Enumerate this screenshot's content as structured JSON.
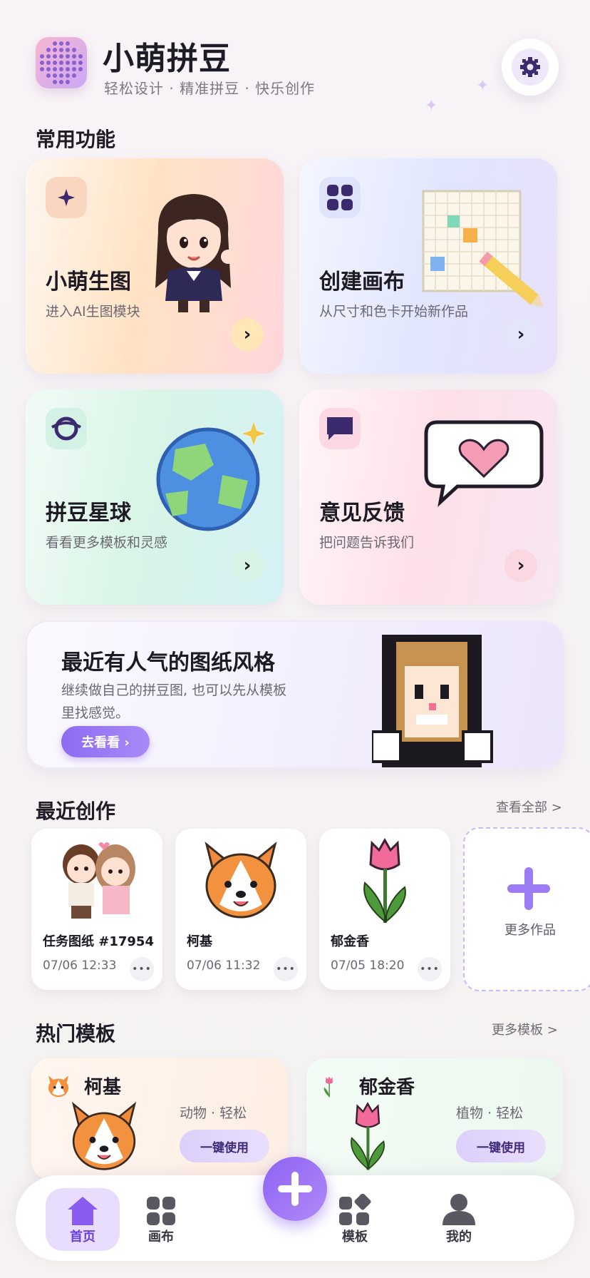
{
  "header": {
    "title": "小萌拼豆",
    "subtitle": "轻松设计 · 精准拼豆 · 快乐创作",
    "settings_icon": "gear-icon",
    "logo_icon": "bead-grid-icon"
  },
  "sections": {
    "common": "常用功能",
    "recent": "最近创作",
    "recent_link": "查看全部 >",
    "hot": "热门模板",
    "hot_link": "更多模板 >"
  },
  "features": [
    {
      "title": "小萌生图",
      "desc": "进入AI生图模块",
      "icon": "sparkle-icon",
      "color": "#f9c2b0"
    },
    {
      "title": "创建画布",
      "desc": "从尺寸和色卡开始新作品",
      "icon": "grid-icon",
      "color": "#c9d1fb"
    },
    {
      "title": "拼豆星球",
      "desc": "看看更多模板和灵感",
      "icon": "planet-icon",
      "color": "#c8f0df"
    },
    {
      "title": "意见反馈",
      "desc": "把问题告诉我们",
      "icon": "chat-icon",
      "color": "#fbc9dc"
    }
  ],
  "banner": {
    "title": "最近有人气的图纸风格",
    "text": "继续做自己的拼豆图, 也可以先从模板里找感觉。",
    "button": "去看看 ›"
  },
  "recent_works": [
    {
      "name": "任务图纸 #17954",
      "time": "07/06 12:33"
    },
    {
      "name": "柯基",
      "time": "07/06 11:32"
    },
    {
      "name": "郁金香",
      "time": "07/05 18:20"
    }
  ],
  "more_works": "更多作品",
  "more_dots": "•••",
  "templates": [
    {
      "name": "柯基",
      "tags": "动物 · 轻松",
      "button": "一键使用"
    },
    {
      "name": "郁金香",
      "tags": "植物 · 轻松",
      "button": "一键使用"
    }
  ],
  "tabbar": {
    "home": "首页",
    "canvas": "画布",
    "templates": "模板",
    "mine": "我的",
    "fab_icon": "plus-icon"
  }
}
